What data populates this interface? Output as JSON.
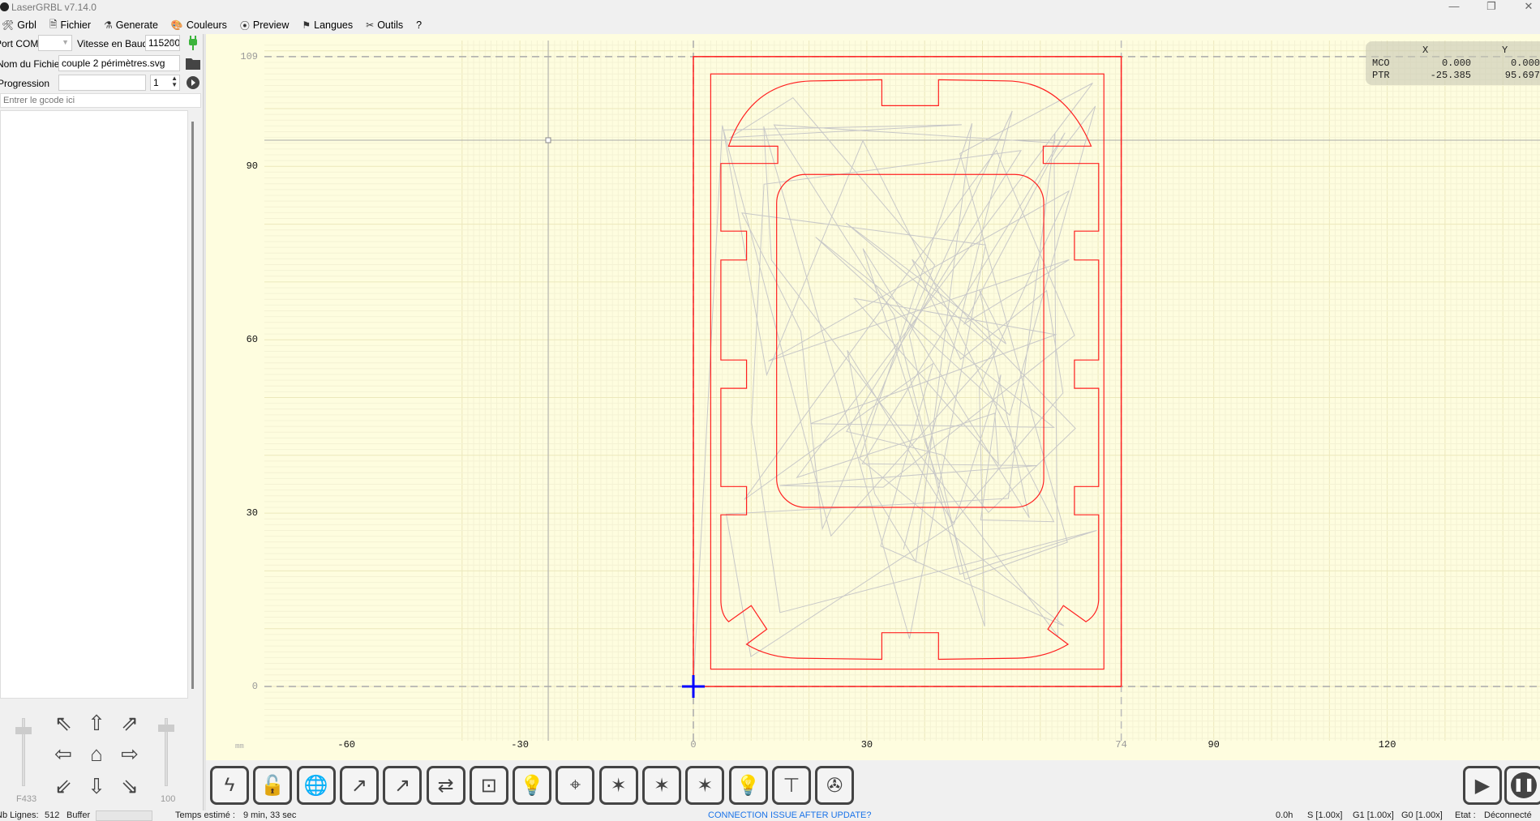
{
  "window": {
    "title": "LaserGRBL v7.14.0",
    "minimize": "—",
    "maximize": "❐",
    "close": "✕"
  },
  "menu": [
    {
      "icon": "🛠",
      "label": "Grbl"
    },
    {
      "icon": "🗎",
      "label": "Fichier"
    },
    {
      "icon": "⚗",
      "label": "Generate"
    },
    {
      "icon": "🎨",
      "label": "Couleurs"
    },
    {
      "icon": "⦿",
      "label": "Preview"
    },
    {
      "icon": "⚑",
      "label": "Langues"
    },
    {
      "icon": "✂",
      "label": "Outils"
    },
    {
      "icon": "",
      "label": "?"
    }
  ],
  "connection": {
    "port_label": "Port COM",
    "port_value": "",
    "baud_label": "Vitesse en Baud",
    "baud_value": "115200"
  },
  "file": {
    "label": "Nom du Fichier",
    "value": "couple 2 périmètres.svg"
  },
  "progress": {
    "label": "Progression",
    "value": 0,
    "count": "1"
  },
  "gcode": {
    "placeholder": "Entrer le gcode ici"
  },
  "jog": {
    "speed_label": "F433",
    "step_label": "100",
    "speed_level": 0.85,
    "step_level": 0.9
  },
  "canvas": {
    "unit": "mm",
    "x_ticks": [
      "-60",
      "-30",
      "0",
      "30",
      "74",
      "90",
      "120"
    ],
    "x_tick_values": [
      -60,
      -30,
      0,
      30,
      74,
      90,
      120
    ],
    "y_ticks": [
      "0",
      "30",
      "60",
      "90",
      "109"
    ],
    "y_tick_values": [
      0,
      30,
      60,
      90,
      109
    ],
    "work_area": {
      "width": 74,
      "height": 109
    },
    "colors": {
      "cut": "#ff2020",
      "travel": "#c8c8c8",
      "origin": "#0000ff",
      "bg": "#fefddf"
    }
  },
  "coords": {
    "col_x": "X",
    "col_y": "Y",
    "rows": [
      {
        "label": "MCO",
        "x": "0.000",
        "y": "0.000"
      },
      {
        "label": "PTR",
        "x": "-25.385",
        "y": "95.697"
      }
    ]
  },
  "toolbar": [
    "reset",
    "unlock",
    "goto-position",
    "frame-path",
    "frame-path-2",
    "frame-rect",
    "center",
    "laser-focus",
    "engrave-target",
    "sparkle-1",
    "sparkle-2",
    "sparkle-3",
    "light",
    "probe",
    "fan"
  ],
  "status": {
    "lines_label": "Nb Lignes:",
    "lines_value": "512",
    "buffer_label": "Buffer",
    "time_label": "Temps estimé :",
    "time_value": "9 min, 33 sec",
    "link": "CONNECTION ISSUE AFTER UPDATE?",
    "time_run": "0.0h",
    "s_override": "S [1.00x]",
    "g1_override": "G1 [1.00x]",
    "g0_override": "G0 [1.00x]",
    "state_label": "Etat :",
    "state_value": "Déconnecté"
  }
}
